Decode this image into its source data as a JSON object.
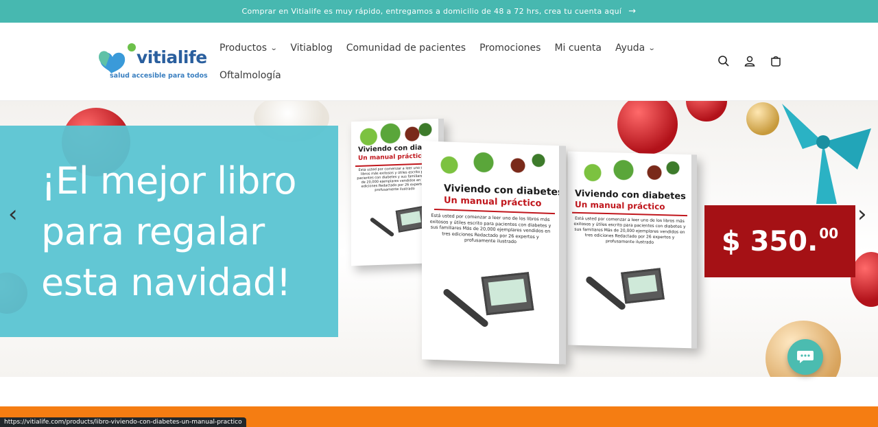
{
  "announcement": {
    "text": "Comprar en Vitialife es muy rápido, entregamos a domicilio de 48 a 72 hrs, crea tu cuenta aquí",
    "arrow": "arrow-right-icon"
  },
  "logo": {
    "name": "vitialife",
    "tagline": "salud accesible para todos"
  },
  "nav": {
    "items": [
      {
        "label": "Productos",
        "has_dropdown": true
      },
      {
        "label": "Vitiablog",
        "has_dropdown": false
      },
      {
        "label": "Comunidad de pacientes",
        "has_dropdown": false
      },
      {
        "label": "Promociones",
        "has_dropdown": false
      },
      {
        "label": "Mi cuenta",
        "has_dropdown": false
      },
      {
        "label": "Ayuda",
        "has_dropdown": true
      },
      {
        "label": "Oftalmología",
        "has_dropdown": false
      }
    ]
  },
  "header_icons": [
    "search-icon",
    "account-icon",
    "cart-icon"
  ],
  "hero": {
    "headline": "¡El mejor libro para regalar esta navidad!",
    "price_main": "$ 350.",
    "price_cents": "00",
    "book": {
      "title": "Viviendo con diabetes",
      "subtitle": "Un manual práctico",
      "blurb": "Está usted por comenzar a leer uno de los libros más exitosos y útiles escrito para pacientes con diabetes y sus familiares Más de 20,000 ejemplares vendidos en tres ediciones Redactado por 26 expertos y profusamente ilustrado"
    },
    "prev_arrow": "‹",
    "next_arrow": "›"
  },
  "colors": {
    "announcement_bg": "#47b8b0",
    "hero_panel": "#5ac4d2",
    "price_tag": "#a51115",
    "chat_button": "#4bbcb0",
    "orange_bar": "#f57d12"
  },
  "status_bar": {
    "url": "https://vitialife.com/products/libro-viviendo-con-diabetes-un-manual-practico"
  }
}
